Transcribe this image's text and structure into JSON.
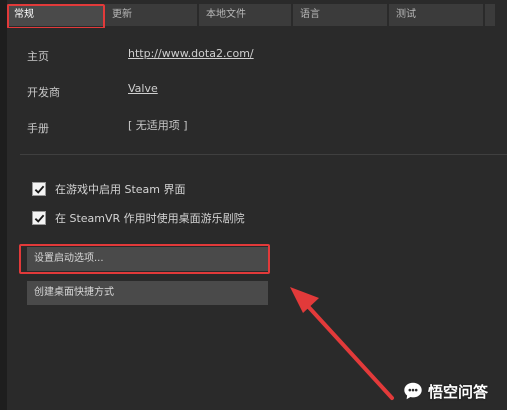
{
  "tabs": [
    {
      "label": "常规",
      "active": true
    },
    {
      "label": "更新",
      "active": false
    },
    {
      "label": "本地文件",
      "active": false
    },
    {
      "label": "语言",
      "active": false
    },
    {
      "label": "测试",
      "active": false
    },
    {
      "label": "",
      "active": false
    }
  ],
  "info": {
    "homepage_label": "主页",
    "homepage_value": "http://www.dota2.com/",
    "developer_label": "开发商",
    "developer_value": "Valve",
    "manual_label": "手册",
    "manual_value": "[ 无适用项 ]"
  },
  "options": [
    {
      "label": "在游戏中启用 Steam 界面",
      "checked": true
    },
    {
      "label": "在 SteamVR 作用时使用桌面游乐剧院",
      "checked": true
    }
  ],
  "buttons": {
    "launch_options": "设置启动选项...",
    "desktop_shortcut": "创建桌面快捷方式"
  },
  "watermark": {
    "text": "悟空问答"
  },
  "colors": {
    "highlight": "#e23a3a",
    "background": "#2a2a2a"
  }
}
